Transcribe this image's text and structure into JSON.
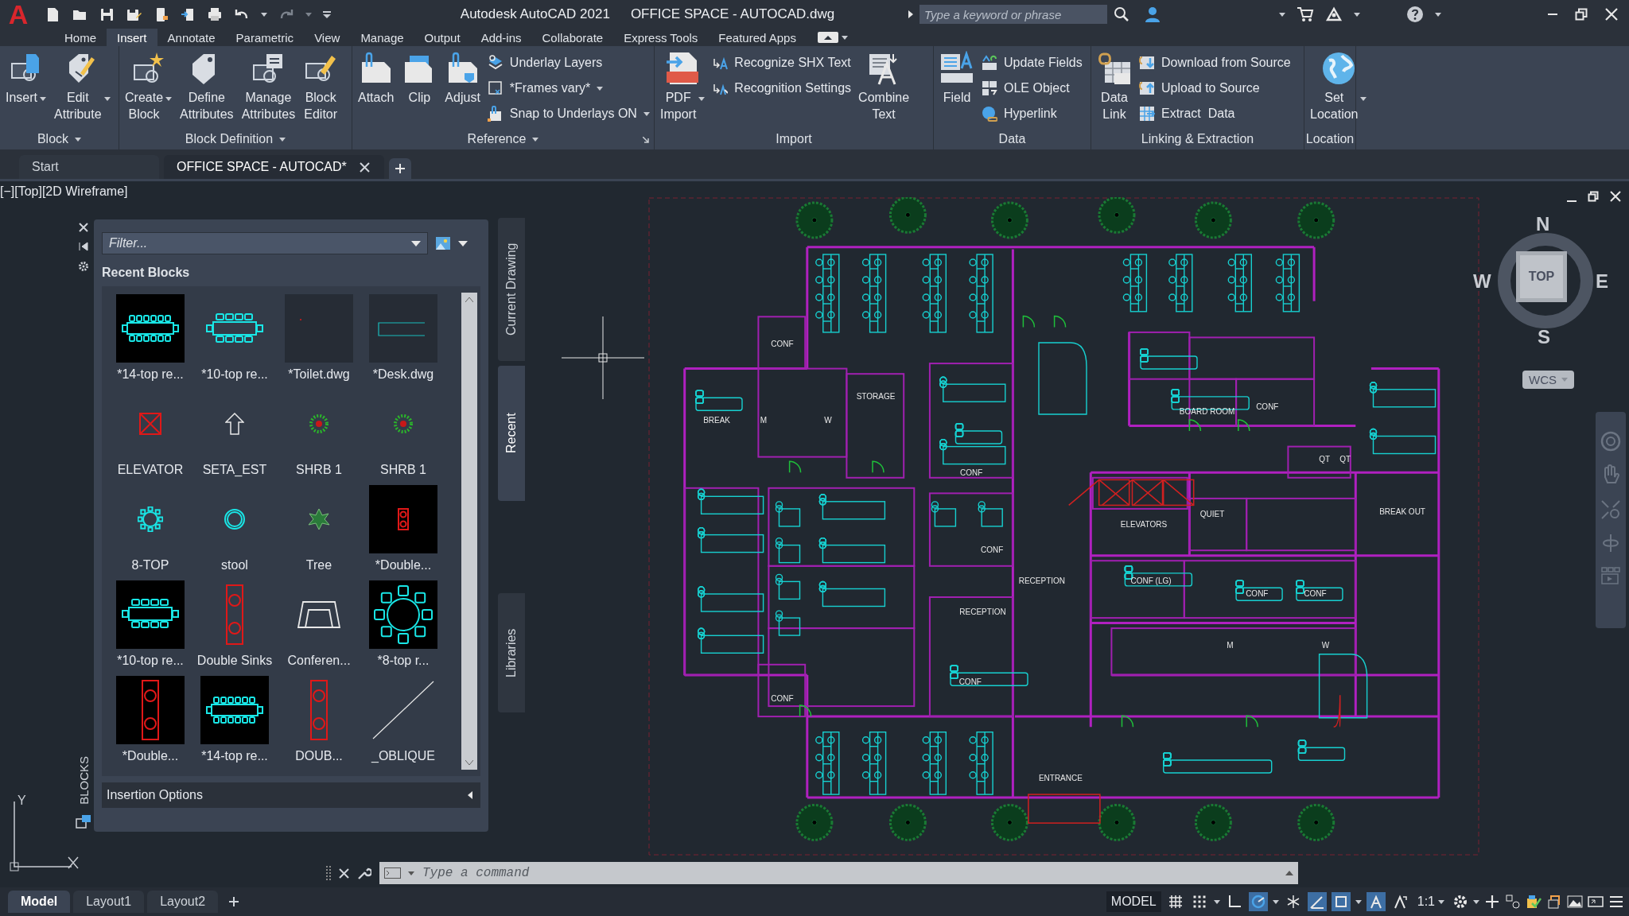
{
  "title_bar": {
    "logo": "A",
    "app_title": "Autodesk AutoCAD 2021",
    "file_title": "OFFICE SPACE - AUTOCAD.dwg",
    "search": {
      "placeholder": "Type a keyword or phrase"
    }
  },
  "ribbon_tabs": [
    {
      "label": "Home",
      "selected": false
    },
    {
      "label": "Insert",
      "selected": true
    },
    {
      "label": "Annotate",
      "selected": false
    },
    {
      "label": "Parametric",
      "selected": false
    },
    {
      "label": "View",
      "selected": false
    },
    {
      "label": "Manage",
      "selected": false
    },
    {
      "label": "Output",
      "selected": false
    },
    {
      "label": "Add-ins",
      "selected": false
    },
    {
      "label": "Collaborate",
      "selected": false
    },
    {
      "label": "Express Tools",
      "selected": false
    },
    {
      "label": "Featured Apps",
      "selected": false
    }
  ],
  "ribbon_panels": [
    {
      "title": "Block",
      "menu": true,
      "launcher": false,
      "items": [
        {
          "kind": "large",
          "label": "Insert",
          "dropdown": true
        },
        {
          "kind": "large",
          "label": "Edit Attribute",
          "dropdown": true
        }
      ]
    },
    {
      "title": "Block Definition",
      "menu": true,
      "launcher": false,
      "items": [
        {
          "kind": "large",
          "label": "Create Block",
          "dropdown": true
        },
        {
          "kind": "large",
          "label": "Define Attributes",
          "dropdown": false
        },
        {
          "kind": "large",
          "label": "Manage Attributes",
          "dropdown": false
        },
        {
          "kind": "large",
          "label": "Block Editor",
          "dropdown": false
        }
      ]
    },
    {
      "title": "Reference",
      "menu": true,
      "launcher": true,
      "items": [
        {
          "kind": "large",
          "label": "Attach",
          "dropdown": false
        },
        {
          "kind": "large",
          "label": "Clip",
          "dropdown": false
        },
        {
          "kind": "large",
          "label": "Adjust",
          "dropdown": false
        },
        {
          "kind": "stack",
          "buttons": [
            {
              "label": "Underlay Layers",
              "dropdown": false
            },
            {
              "label": "*Frames vary*",
              "dropdown": true
            },
            {
              "label": "Snap to Underlays ON",
              "dropdown": true
            }
          ]
        }
      ]
    },
    {
      "title": "Import",
      "menu": false,
      "launcher": false,
      "items": [
        {
          "kind": "large",
          "label": "PDF Import",
          "dropdown": true
        },
        {
          "kind": "stack",
          "buttons": [
            {
              "label": "Recognize SHX Text",
              "dropdown": false
            },
            {
              "label": "Recognition Settings",
              "dropdown": false
            }
          ]
        },
        {
          "kind": "large",
          "label": "Combine Text",
          "dropdown": false
        }
      ]
    },
    {
      "title": "Data",
      "menu": false,
      "launcher": false,
      "items": [
        {
          "kind": "large",
          "label": "Field",
          "dropdown": false
        },
        {
          "kind": "stack",
          "buttons": [
            {
              "label": "Update Fields",
              "dropdown": false
            },
            {
              "label": "OLE Object",
              "dropdown": false
            },
            {
              "label": "Hyperlink",
              "dropdown": false
            }
          ]
        }
      ]
    },
    {
      "title": "Linking & Extraction",
      "menu": false,
      "launcher": false,
      "items": [
        {
          "kind": "large",
          "label": "Data Link",
          "dropdown": false
        },
        {
          "kind": "stack",
          "buttons": [
            {
              "label": "Download from Source",
              "dropdown": false
            },
            {
              "label": "Upload to Source",
              "dropdown": false
            },
            {
              "label": "Extract  Data",
              "dropdown": false
            }
          ]
        }
      ]
    },
    {
      "title": "Location",
      "menu": false,
      "launcher": false,
      "items": [
        {
          "kind": "large",
          "label": "Set Location",
          "dropdown": true
        }
      ]
    }
  ],
  "doc_tabs": [
    {
      "label": "Start",
      "selected": false,
      "closable": false
    },
    {
      "label": "OFFICE SPACE - AUTOCAD*",
      "selected": true,
      "closable": true
    }
  ],
  "viewport": {
    "label": "[−][Top][2D Wireframe]"
  },
  "block_palette": {
    "title": "BLOCKS",
    "filter": {
      "placeholder": "Filter..."
    },
    "section_title": "Recent Blocks",
    "side_tabs": [
      {
        "label": "Current Drawing",
        "selected": false
      },
      {
        "label": "Recent",
        "selected": true
      },
      {
        "label": "Libraries",
        "selected": false
      }
    ],
    "blocks": [
      {
        "label": "*14-top re...",
        "kind": "long-table-dark"
      },
      {
        "label": "*10-top re...",
        "kind": "table"
      },
      {
        "label": "*Toilet.dwg",
        "kind": "dot-framed"
      },
      {
        "label": "*Desk.dwg",
        "kind": "desk-framed"
      },
      {
        "label": "ELEVATOR",
        "kind": "elevator"
      },
      {
        "label": "SETA_EST",
        "kind": "arrow"
      },
      {
        "label": "SHRB 1",
        "kind": "shrub"
      },
      {
        "label": "SHRB 1",
        "kind": "shrub"
      },
      {
        "label": "8-TOP",
        "kind": "round-table"
      },
      {
        "label": "stool",
        "kind": "stool"
      },
      {
        "label": "Tree",
        "kind": "tree"
      },
      {
        "label": "*Double...",
        "kind": "small-sinks-dark"
      },
      {
        "label": "*10-top re...",
        "kind": "table-dark"
      },
      {
        "label": "Double Sinks",
        "kind": "sinks"
      },
      {
        "label": "Conferen...",
        "kind": "chair"
      },
      {
        "label": "*8-top r...",
        "kind": "big-round-table-dark"
      },
      {
        "label": "*Double...",
        "kind": "sinks-dark"
      },
      {
        "label": "*14-top re...",
        "kind": "long-table-dark"
      },
      {
        "label": "DOUB...",
        "kind": "sinks"
      },
      {
        "label": "_OBLIQUE",
        "kind": "line"
      }
    ],
    "insertion_options": {
      "label": "Insertion Options",
      "expanded": false
    }
  },
  "floor_plan": {
    "room_labels": [
      "CONF",
      "STORAGE",
      "BREAK",
      "M",
      "W",
      "CONF",
      "BOARD ROOM",
      "CONF",
      "QT",
      "QT",
      "ELEVATORS",
      "QUIET",
      "BREAK OUT",
      "CONF",
      "RECEPTION",
      "CONF (LG)",
      "CONF",
      "CONF",
      "RECEPTION",
      "M",
      "W",
      "CONF",
      "CONF",
      "ENTRANCE"
    ]
  },
  "compass": {
    "north": "N",
    "south": "S",
    "east": "E",
    "west": "W",
    "face": "TOP",
    "ucs": "WCS"
  },
  "ucs_icon": {
    "y_axis": "Y"
  },
  "command_line": {
    "placeholder": "Type a command"
  },
  "layout_tabs": [
    {
      "label": "Model",
      "selected": true
    },
    {
      "label": "Layout1",
      "selected": false
    },
    {
      "label": "Layout2",
      "selected": false
    }
  ],
  "status_bar": {
    "space": "MODEL",
    "scale": "1:1",
    "toggles": [
      {
        "kind": "grid",
        "on": false
      },
      {
        "kind": "snap",
        "on": false
      },
      {
        "kind": "ortho",
        "on": false
      },
      {
        "kind": "polar",
        "on": true
      },
      {
        "kind": "isodraft",
        "on": false
      },
      {
        "kind": "tracking",
        "on": true
      },
      {
        "kind": "osnap",
        "on": true
      },
      {
        "kind": "annotation",
        "on": true
      },
      {
        "kind": "autoscale",
        "on": false
      }
    ]
  }
}
